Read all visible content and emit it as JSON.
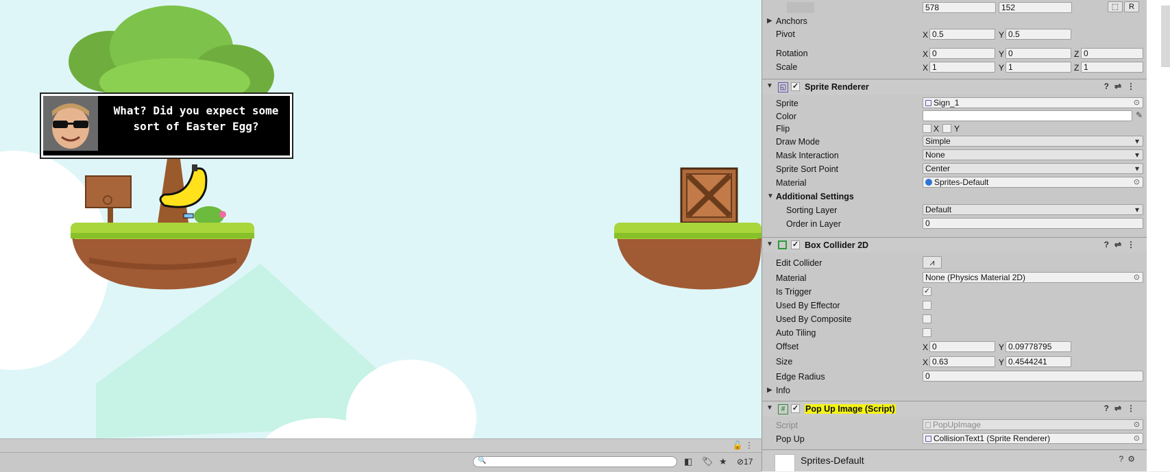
{
  "game": {
    "dialog_text": "What? Did you expect some sort of Easter Egg?"
  },
  "gameview": {
    "search_placeholder": "",
    "hidden_count": "17"
  },
  "rect_transform": {
    "width": "578",
    "height": "152",
    "r_button": "R",
    "anchors_label": "Anchors",
    "pivot_label": "Pivot",
    "pivot_x": "0.5",
    "pivot_y": "0.5",
    "rotation_label": "Rotation",
    "rotation_x": "0",
    "rotation_y": "0",
    "rotation_z": "0",
    "scale_label": "Scale",
    "scale_x": "1",
    "scale_y": "1",
    "scale_z": "1"
  },
  "axes": {
    "x": "X",
    "y": "Y",
    "z": "Z"
  },
  "sprite_renderer": {
    "title": "Sprite Renderer",
    "sprite_label": "Sprite",
    "sprite_value": "Sign_1",
    "color_label": "Color",
    "flip_label": "Flip",
    "draw_mode_label": "Draw Mode",
    "draw_mode_value": "Simple",
    "mask_label": "Mask Interaction",
    "mask_value": "None",
    "sort_point_label": "Sprite Sort Point",
    "sort_point_value": "Center",
    "material_label": "Material",
    "material_value": "Sprites-Default",
    "additional_label": "Additional Settings",
    "sorting_layer_label": "Sorting Layer",
    "sorting_layer_value": "Default",
    "order_label": "Order in Layer",
    "order_value": "0"
  },
  "box_collider": {
    "title": "Box Collider 2D",
    "edit_label": "Edit Collider",
    "material_label": "Material",
    "material_value": "None (Physics Material 2D)",
    "trigger_label": "Is Trigger",
    "trigger_check": "✓",
    "effector_label": "Used By Effector",
    "composite_label": "Used By Composite",
    "autotiling_label": "Auto Tiling",
    "offset_label": "Offset",
    "offset_x": "0",
    "offset_y": "0.09778795",
    "size_label": "Size",
    "size_x": "0.63",
    "size_y": "0.4544241",
    "edge_label": "Edge Radius",
    "edge_value": "0",
    "info_label": "Info"
  },
  "popup_script": {
    "title": "Pop Up Image (Script)",
    "script_label": "Script",
    "script_value": "PopUpImage",
    "popup_label": "Pop Up",
    "popup_value": "CollisionText1 (Sprite Renderer)"
  },
  "footer": {
    "material_name": "Sprites-Default"
  },
  "colors": {
    "sky": "#dff6f8",
    "grass": "#a9d63b",
    "dirt": "#a05a34",
    "highlight": "#f4f415"
  }
}
